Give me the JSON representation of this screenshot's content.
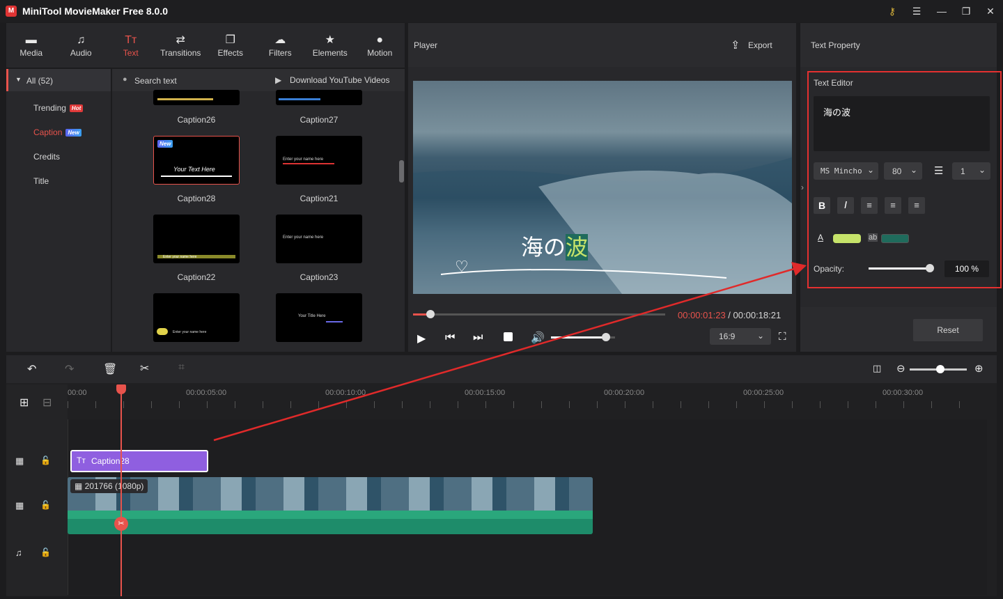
{
  "window": {
    "title": "MiniTool MovieMaker Free 8.0.0"
  },
  "tabs": [
    {
      "label": "Media",
      "icon": "folder-icon"
    },
    {
      "label": "Audio",
      "icon": "music-note-icon"
    },
    {
      "label": "Text",
      "icon": "text-icon"
    },
    {
      "label": "Transitions",
      "icon": "transitions-icon"
    },
    {
      "label": "Effects",
      "icon": "effects-icon"
    },
    {
      "label": "Filters",
      "icon": "filters-icon"
    },
    {
      "label": "Elements",
      "icon": "elements-icon"
    },
    {
      "label": "Motion",
      "icon": "motion-icon"
    }
  ],
  "active_tab": "Text",
  "sidebar": {
    "header": "All (52)",
    "items": [
      {
        "label": "Trending",
        "badge": "Hot"
      },
      {
        "label": "Caption",
        "badge": "New"
      },
      {
        "label": "Credits",
        "badge": ""
      },
      {
        "label": "Title",
        "badge": ""
      }
    ]
  },
  "gallery": {
    "search_placeholder": "Search text",
    "download_label": "Download YouTube Videos",
    "new_badge": "New",
    "items": [
      "Caption26",
      "Caption27",
      "Caption28",
      "Caption21",
      "Caption22",
      "Caption23"
    ],
    "thumb_texts": {
      "c28": "Your Text Here",
      "c21": "Enter your name here",
      "c22": "Enter your name here",
      "c23": "Enter your name here",
      "c24": "Enter your name here",
      "c25": "Your Title Here"
    }
  },
  "player": {
    "title": "Player",
    "export_label": "Export",
    "overlay_text_a": "海の",
    "overlay_text_b": "波",
    "time_current": "00:00:01:23",
    "time_separator": " / ",
    "time_total": "00:00:18:21",
    "aspect": "16:9",
    "progress": 0.07,
    "volume": 0.86
  },
  "text_property": {
    "title": "Text Property",
    "editor_label": "Text Editor",
    "editor_value": "海の波",
    "font": "MS Mincho",
    "size": "80",
    "line_spacing": "1",
    "bold": "B",
    "italic": "I",
    "font_color": "#c6e36a",
    "bg_color": "#1f6b5c",
    "font_color_label": "A",
    "bg_color_label": "ab",
    "opacity_label": "Opacity:",
    "opacity_value": "100 %",
    "opacity": 1.0,
    "reset_label": "Reset"
  },
  "timeline": {
    "ticks": [
      "00:00",
      "00:00:05:00",
      "00:00:10:00",
      "00:00:15:00",
      "00:00:20:00",
      "00:00:25:00",
      "00:00:30:00"
    ],
    "text_clip": "Caption28",
    "video_clip": "201766 (1080p)"
  },
  "colors": {
    "accent": "#e8534c",
    "text_clip": "#8f5fe0",
    "audio_track": "#1e8c6a"
  }
}
